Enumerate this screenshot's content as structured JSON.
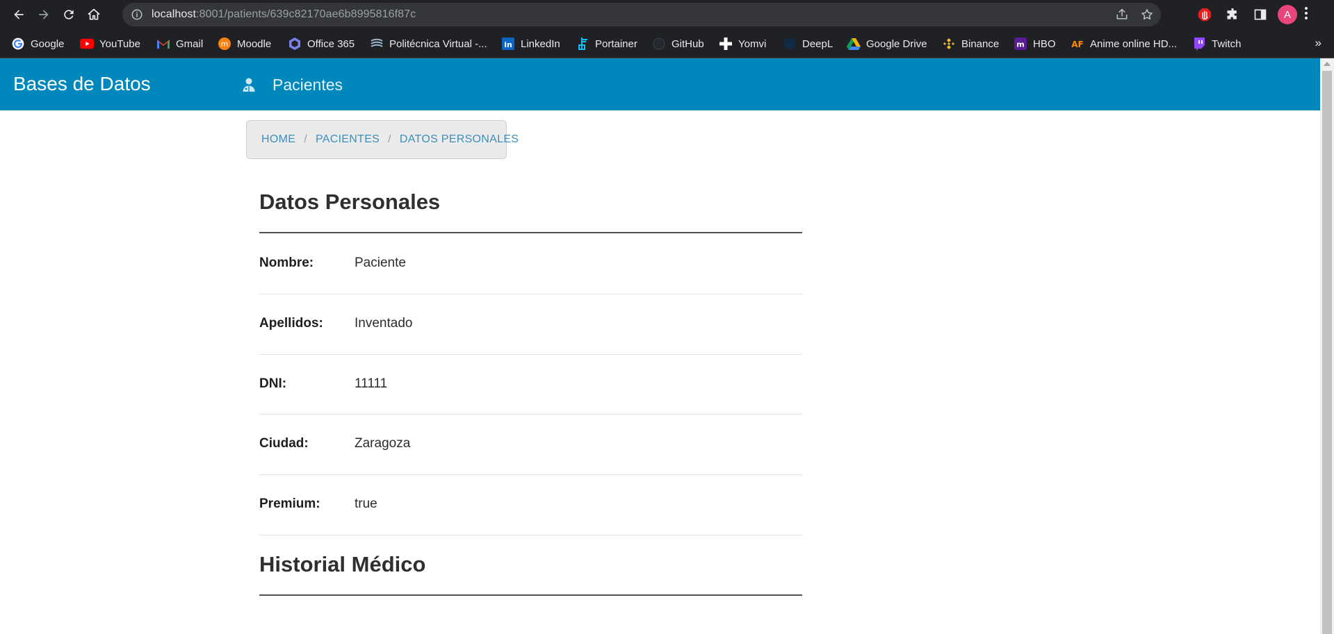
{
  "browser": {
    "url_host": "localhost",
    "url_rest": ":8001/patients/639c82170ae6b8995816f87c",
    "avatar_letter": "A",
    "overflow_glyph": "»",
    "bookmarks": [
      {
        "label": "Google",
        "icon": "google-icon",
        "color": "#4285f4"
      },
      {
        "label": "YouTube",
        "icon": "youtube-icon",
        "color": "#ff0000"
      },
      {
        "label": "Gmail",
        "icon": "gmail-icon",
        "color": "#ea4335"
      },
      {
        "label": "Moodle",
        "icon": "moodle-icon",
        "color": "#f98012"
      },
      {
        "label": "Office 365",
        "icon": "office-icon",
        "color": "#7b83eb"
      },
      {
        "label": "Politécnica Virtual -...",
        "icon": "politecnica-icon",
        "color": "#9bb7c9"
      },
      {
        "label": "LinkedIn",
        "icon": "linkedin-icon",
        "color": "#0a66c2"
      },
      {
        "label": "Portainer",
        "icon": "portainer-icon",
        "color": "#13bef9"
      },
      {
        "label": "GitHub",
        "icon": "github-icon",
        "color": "#24292f"
      },
      {
        "label": "Yomvi",
        "icon": "yomvi-icon",
        "color": "#ffffff"
      },
      {
        "label": "DeepL",
        "icon": "deepl-icon",
        "color": "#0f2b46"
      },
      {
        "label": "Google Drive",
        "icon": "drive-icon",
        "color": "#0f9d58"
      },
      {
        "label": "Binance",
        "icon": "binance-icon",
        "color": "#f3ba2f"
      },
      {
        "label": "HBO",
        "icon": "hbo-icon",
        "color": "#5c1a94"
      },
      {
        "label": "Anime online HD...",
        "icon": "animeflv-icon",
        "color": "#ff8a00"
      },
      {
        "label": "Twitch",
        "icon": "twitch-icon",
        "color": "#9146ff"
      }
    ]
  },
  "header": {
    "brand": "Bases de Datos",
    "nav_patients": "Pacientes",
    "background": "#0088bd"
  },
  "breadcrumb": {
    "items": [
      "HOME",
      "PACIENTES",
      "DATOS PERSONALES"
    ],
    "separator": "/"
  },
  "personal": {
    "title": "Datos Personales",
    "fields": [
      {
        "label": "Nombre:",
        "value": "Paciente"
      },
      {
        "label": "Apellidos:",
        "value": "Inventado"
      },
      {
        "label": "DNI:",
        "value": "11111"
      },
      {
        "label": "Ciudad:",
        "value": "Zaragoza"
      },
      {
        "label": "Premium:",
        "value": "true"
      }
    ]
  },
  "history": {
    "title": "Historial Médico"
  }
}
